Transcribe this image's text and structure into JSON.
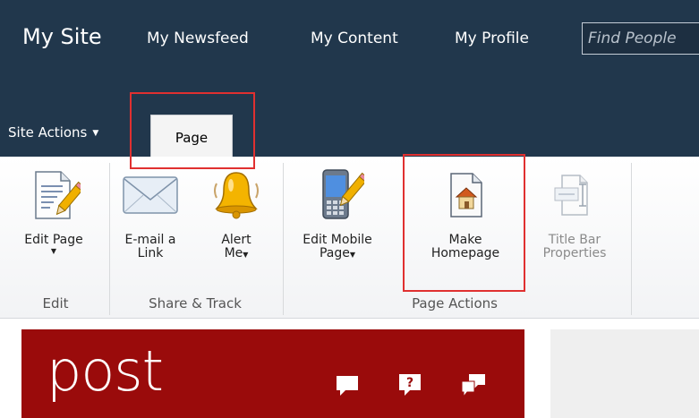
{
  "top_nav": {
    "site_title": "My Site",
    "links": [
      "My Newsfeed",
      "My Content",
      "My Profile"
    ],
    "search_placeholder": "Find People"
  },
  "ribbon_tabs": {
    "site_actions": "Site Actions",
    "active_tab": "Page"
  },
  "ribbon": {
    "groups": [
      {
        "label": "Edit",
        "buttons": [
          {
            "label": "Edit Page",
            "icon": "edit-page-icon",
            "dropdown": true
          }
        ]
      },
      {
        "label": "Share & Track",
        "buttons": [
          {
            "label": "E-mail a\nLink",
            "icon": "email-envelope-icon"
          },
          {
            "label": "Alert\nMe",
            "icon": "alert-bell-icon",
            "dropdown": true
          }
        ]
      },
      {
        "label": "Page Actions",
        "buttons": [
          {
            "label": "Edit Mobile\nPage",
            "icon": "edit-mobile-page-icon",
            "dropdown": true
          },
          {
            "label": "Make\nHomepage",
            "icon": "make-homepage-icon"
          },
          {
            "label": "Title Bar\nProperties",
            "icon": "title-bar-properties-icon",
            "disabled": true
          }
        ]
      }
    ]
  },
  "content": {
    "title": "post",
    "icons": [
      "comment-icon",
      "help-question-icon",
      "feedback-icon"
    ]
  },
  "colors": {
    "top_bar": "#21374c",
    "highlight": "#e03030",
    "content_panel": "#9a0b0b"
  }
}
